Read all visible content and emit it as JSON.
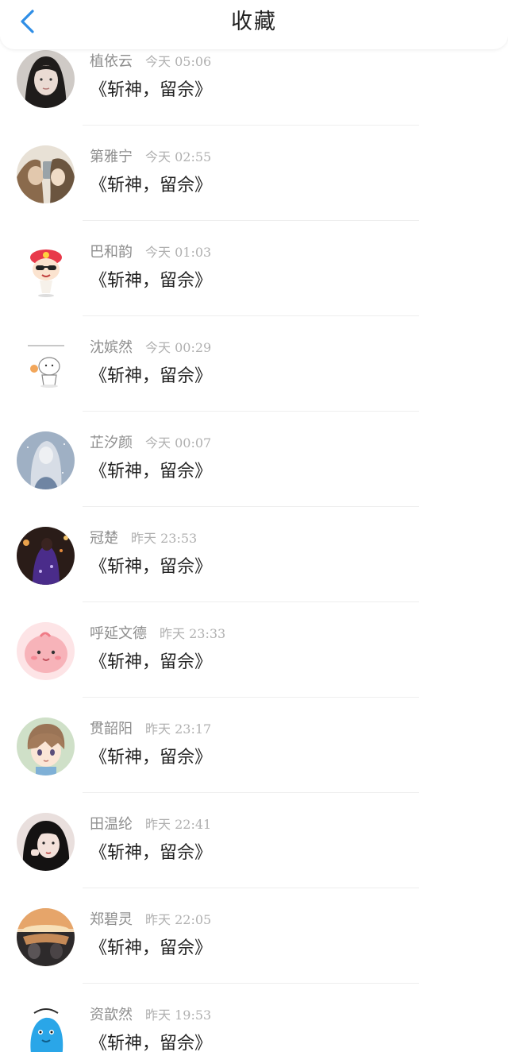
{
  "header": {
    "title": "收藏",
    "back_icon": "chevron-left-icon",
    "accent_color": "#2f8ee6"
  },
  "favorites": [
    {
      "name": "植依云",
      "time": "今天 05:06",
      "text": "《斩神，留佘》",
      "avatar": "photo-woman-dark-hair"
    },
    {
      "name": "第雅宁",
      "time": "今天 02:55",
      "text": "《斩神，留佘》",
      "avatar": "photo-selfie-phone"
    },
    {
      "name": "巴和韵",
      "time": "今天 01:03",
      "text": "《斩神，留佘》",
      "avatar": "cartoon-sunglasses-pink-hat"
    },
    {
      "name": "沈嫔然",
      "time": "今天 00:29",
      "text": "《斩神，留佘》",
      "avatar": "cartoon-doodle-bear"
    },
    {
      "name": "芷汐颜",
      "time": "今天 00:07",
      "text": "《斩神，留佘》",
      "avatar": "anime-girl-silver"
    },
    {
      "name": "冠楚",
      "time": "昨天 23:53",
      "text": "《斩神，留佘》",
      "avatar": "photo-night-city"
    },
    {
      "name": "呼延文德",
      "time": "昨天 23:33",
      "text": "《斩神，留佘》",
      "avatar": "cartoon-pink-blob"
    },
    {
      "name": "贯韶阳",
      "time": "昨天 23:17",
      "text": "《斩神，留佘》",
      "avatar": "anime-boy-brown-hair"
    },
    {
      "name": "田温纶",
      "time": "昨天 22:41",
      "text": "《斩神，留佘》",
      "avatar": "photo-girl-black-hair"
    },
    {
      "name": "郑碧灵",
      "time": "昨天 22:05",
      "text": "《斩神，留佘》",
      "avatar": "photo-car-sunset"
    },
    {
      "name": "资歆然",
      "time": "昨天 19:53",
      "text": "《斩神，留佘》",
      "avatar": "cartoon-blue-creature"
    }
  ]
}
